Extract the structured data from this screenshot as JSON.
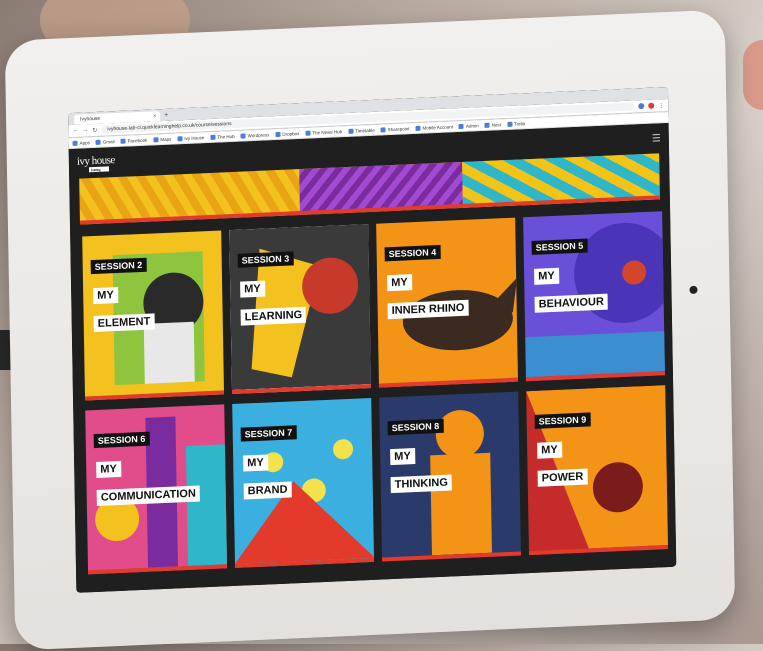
{
  "browser": {
    "tab_title": "Ivyhouse",
    "url": "ivyhouse-lab-cl.quicklearninghelp.co.uk/course/sessions",
    "bookmarks": [
      "Apps",
      "Gmail",
      "Facebook",
      "Maps",
      "Ivy House",
      "The Hub",
      "Wordpress",
      "Dropbox",
      "The News Hub",
      "Timetable",
      "Sharepoint",
      "Mobile Account",
      "Admin",
      "Nest",
      "Trello"
    ]
  },
  "site": {
    "logo": "ivy house",
    "logo_badge": "learning"
  },
  "sessions": [
    {
      "session": "SESSION 2",
      "line1": "MY",
      "line2": "ELEMENT"
    },
    {
      "session": "SESSION 3",
      "line1": "MY",
      "line2": "LEARNING"
    },
    {
      "session": "SESSION 4",
      "line1": "MY",
      "line2": "INNER RHINO"
    },
    {
      "session": "SESSION 5",
      "line1": "MY",
      "line2": "BEHAVIOUR"
    },
    {
      "session": "SESSION 6",
      "line1": "MY",
      "line2": "COMMUNICATION"
    },
    {
      "session": "SESSION 7",
      "line1": "MY",
      "line2": "BRAND"
    },
    {
      "session": "SESSION 8",
      "line1": "MY",
      "line2": "THINKING"
    },
    {
      "session": "SESSION 9",
      "line1": "MY",
      "line2": "POWER"
    }
  ],
  "colors": {
    "accent_red": "#e23a2b",
    "yellow": "#f3c21e",
    "orange": "#f39416",
    "purple": "#6a4fd8",
    "teal": "#2fb6c8"
  }
}
